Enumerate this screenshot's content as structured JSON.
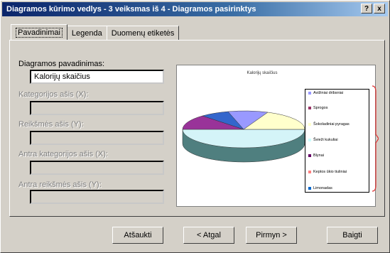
{
  "window": {
    "title": "Diagramos kūrimo vedlys - 3 veiksmas iš 4 - Diagramos pasirinktys",
    "help_label": "?",
    "close_label": "x"
  },
  "tabs": [
    {
      "label": "Pavadinimai",
      "active": true
    },
    {
      "label": "Legenda",
      "active": false
    },
    {
      "label": "Duomenų etiketės",
      "active": false
    }
  ],
  "fields": {
    "chart_title": {
      "label": "Diagramos pavadinimas:",
      "value": "Kalorijų skaičius"
    },
    "category_x": {
      "label": "Kategorijos ašis (X):",
      "value": ""
    },
    "value_y": {
      "label": "Reikšmės ašis (Y):",
      "value": ""
    },
    "second_category_x": {
      "label": "Antra kategorijos ašis (X):",
      "value": ""
    },
    "second_value_y": {
      "label": "Antra reikšmės ašis (Y):",
      "value": ""
    }
  },
  "preview": {
    "title": "Kalorijų skaičius",
    "legend": [
      {
        "label": "Avižiniai dribsniai",
        "color": "#9999ff"
      },
      {
        "label": "Sprogos",
        "color": "#993366"
      },
      {
        "label": "Šokoladiniai pyragas",
        "color": "#ffffcc"
      },
      {
        "label": "Švieži kukuliai",
        "color": "#ccffff"
      },
      {
        "label": "Blynai",
        "color": "#660066"
      },
      {
        "label": "Keptos ūkio tiuliniai",
        "color": "#ff8080"
      },
      {
        "label": "Limonadas",
        "color": "#0066cc"
      }
    ]
  },
  "buttons": {
    "cancel": "Atšaukti",
    "back": "< Atgal",
    "next": "Pirmyn >",
    "finish": "Baigti"
  },
  "colors": {
    "title_start": "#0a246a",
    "title_end": "#a6caf0",
    "face": "#d4d0c8",
    "bracket": "#e03030"
  }
}
